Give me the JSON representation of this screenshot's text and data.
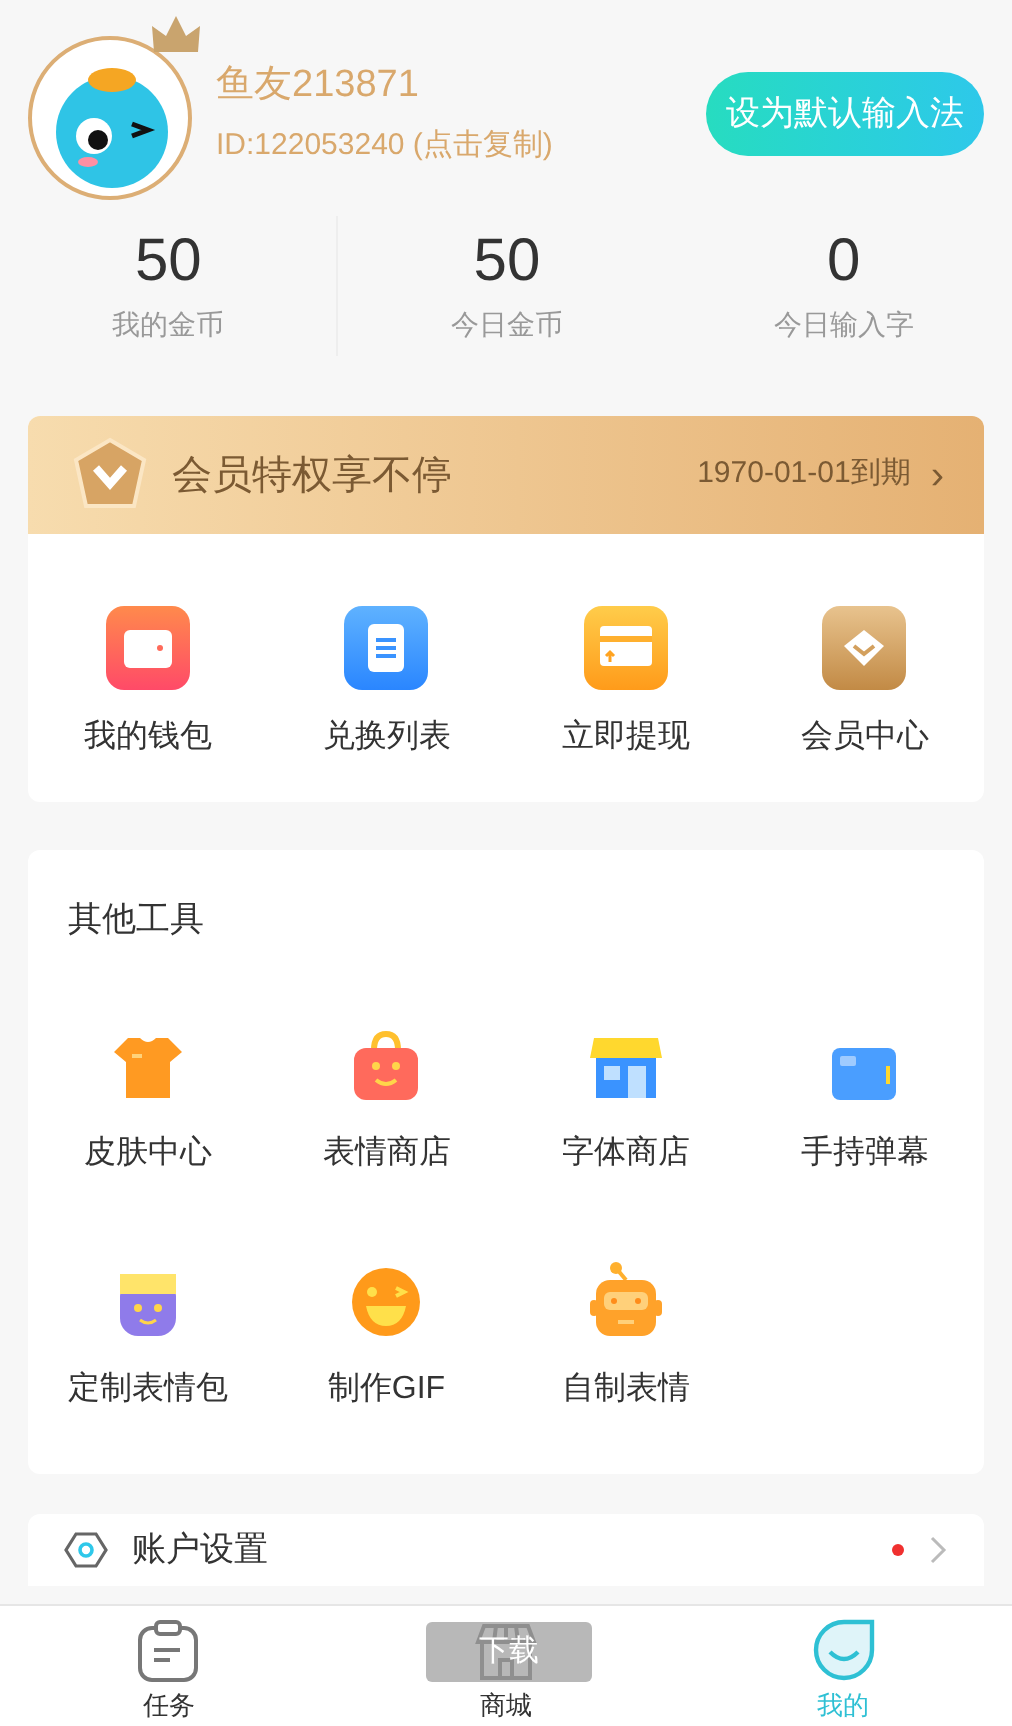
{
  "profile": {
    "name": "鱼友213871",
    "id_text": "ID:122053240 (点击复制)",
    "action_button": "设为默认输入法"
  },
  "stats": [
    {
      "value": "50",
      "label": "我的金币"
    },
    {
      "value": "50",
      "label": "今日金币"
    },
    {
      "value": "0",
      "label": "今日输入字"
    }
  ],
  "membership": {
    "title": "会员特权享不停",
    "expiry": "1970-01-01到期",
    "chevron": "›",
    "items": [
      {
        "label": "我的钱包"
      },
      {
        "label": "兑换列表"
      },
      {
        "label": "立即提现"
      },
      {
        "label": "会员中心"
      }
    ]
  },
  "other_tools": {
    "title": "其他工具",
    "items": [
      {
        "label": "皮肤中心"
      },
      {
        "label": "表情商店"
      },
      {
        "label": "字体商店"
      },
      {
        "label": "手持弹幕"
      },
      {
        "label": "定制表情包"
      },
      {
        "label": "制作GIF"
      },
      {
        "label": "自制表情"
      }
    ]
  },
  "account_row": {
    "label": "账户设置",
    "unread": true
  },
  "tab_bar": [
    {
      "label": "任务",
      "selected": false
    },
    {
      "label": "商城",
      "selected": false
    },
    {
      "label": "我的",
      "selected": true
    }
  ],
  "toast": {
    "text": "下载"
  }
}
